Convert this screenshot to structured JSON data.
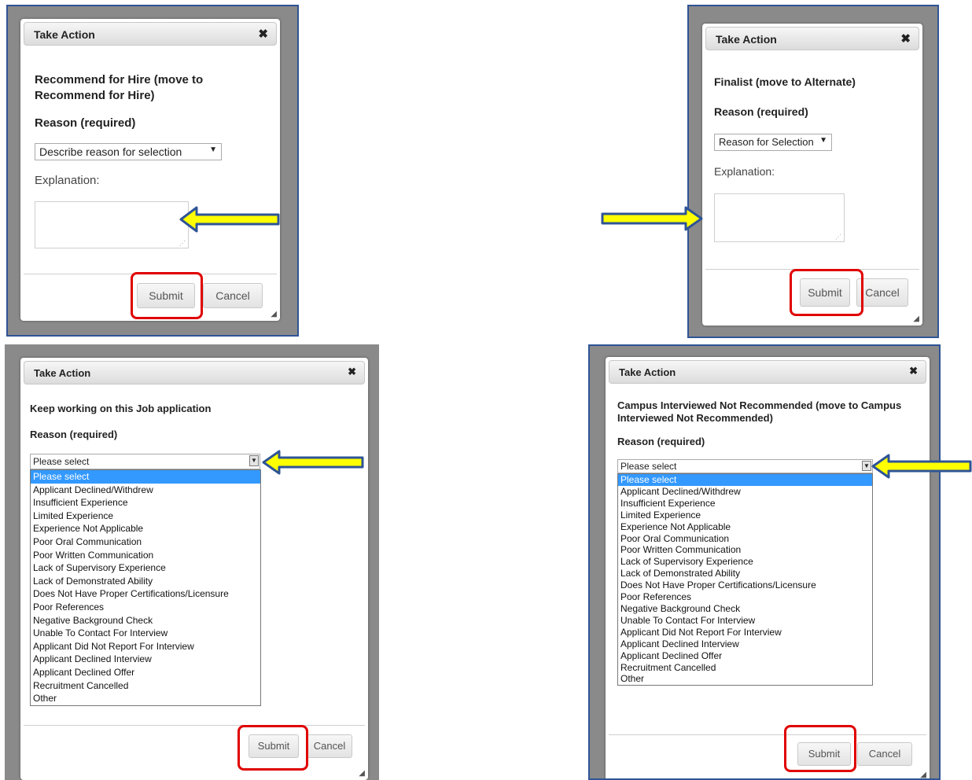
{
  "title": "Take Action",
  "close_glyph": "✖",
  "arrow_color": "#ffff00",
  "arrow_border": "#2f5496",
  "highlight_color": "#e00000",
  "dialogs": {
    "d1": {
      "heading": "Recommend for Hire (move to Recommend for Hire)",
      "reason_label": "Reason (required)",
      "select_value": "Describe reason for selection",
      "explanation_label": "Explanation:",
      "submit": "Submit",
      "cancel": "Cancel"
    },
    "d2": {
      "heading": "Finalist (move to Alternate)",
      "reason_label": "Reason (required)",
      "select_value": "Reason for Selection",
      "explanation_label": "Explanation:",
      "submit": "Submit",
      "cancel": "Cancel"
    },
    "d3": {
      "heading": "Keep working on this Job application",
      "reason_label": "Reason (required)",
      "select_value": "Please select",
      "submit": "Submit",
      "cancel": "Cancel",
      "options": [
        "Please select",
        "Applicant Declined/Withdrew",
        "Insufficient Experience",
        "Limited Experience",
        "Experience Not Applicable",
        "Poor Oral Communication",
        "Poor Written Communication",
        "Lack of Supervisory Experience",
        "Lack of Demonstrated Ability",
        "Does Not Have Proper Certifications/Licensure",
        "Poor References",
        "Negative Background Check",
        "Unable To Contact For Interview",
        "Applicant Did Not Report For Interview",
        "Applicant Declined Interview",
        "Applicant Declined Offer",
        "Recruitment Cancelled",
        "Other"
      ]
    },
    "d4": {
      "heading": "Campus Interviewed Not Recommended (move to Campus Interviewed Not Recommended)",
      "reason_label": "Reason (required)",
      "select_value": "Please select",
      "submit": "Submit",
      "cancel": "Cancel",
      "options": [
        "Please select",
        "Applicant Declined/Withdrew",
        "Insufficient Experience",
        "Limited Experience",
        "Experience Not Applicable",
        "Poor Oral Communication",
        "Poor Written Communication",
        "Lack of Supervisory Experience",
        "Lack of Demonstrated Ability",
        "Does Not Have Proper Certifications/Licensure",
        "Poor References",
        "Negative Background Check",
        "Unable To Contact For Interview",
        "Applicant Did Not Report For Interview",
        "Applicant Declined Interview",
        "Applicant Declined Offer",
        "Recruitment Cancelled",
        "Other"
      ]
    }
  }
}
